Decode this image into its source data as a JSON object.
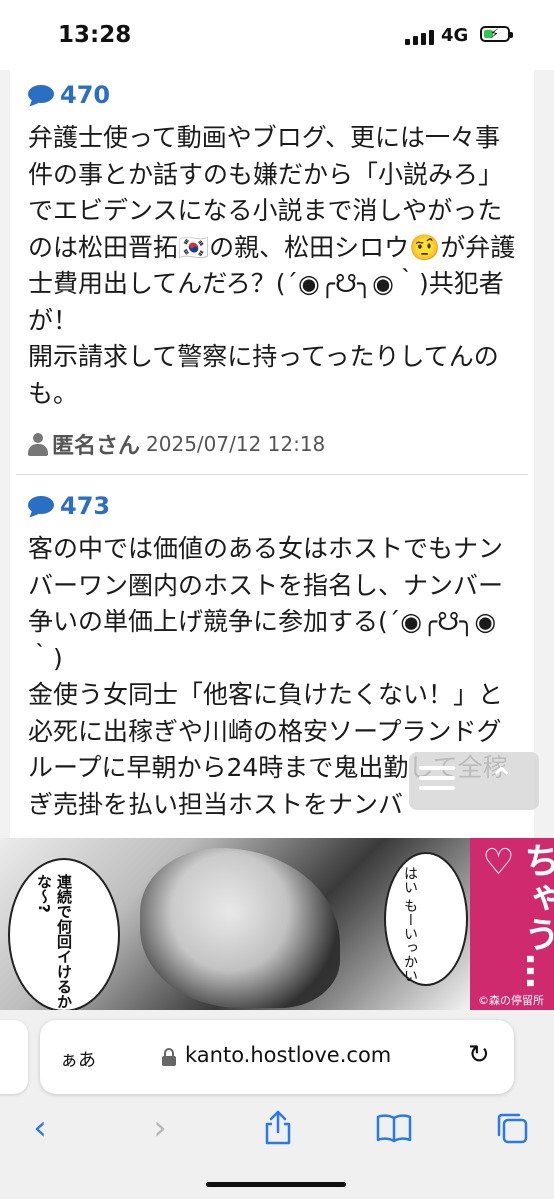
{
  "status_bar": {
    "time": "13:28",
    "network": "4G",
    "signal_icon": "cellular-signal-icon",
    "battery_icon": "battery-charging-icon"
  },
  "posts": [
    {
      "number": "470",
      "text": "弁護士使って動画やブログ、更には一々事件の事とか話すのも嫌だから「小説みろ」でエビデンスになる小説まで消しやがったのは松田晋拓🇰🇷の親、松田シロウ🤨が弁護士費用出してんだろ？(´◉╭☋╮◉｀)共犯者が！\n開示請求して警察に持ってったりしてんのも。",
      "author": "匿名さん",
      "timestamp": "2025/07/12 12:18"
    },
    {
      "number": "473",
      "text": "客の中では価値のある女はホストでもナンバーワン圏内のホストを指名し、ナンバー争いの単価上げ競争に参加する(´◉╭☋╮◉｀)\n金使う女同士「他客に負けたくない！」と必死に出稼ぎや川崎の格安ソープランドグループに早朝から24時まで鬼出勤して全稼ぎ売掛を払い担当ホストをナンバ",
      "author": "",
      "timestamp": ""
    }
  ],
  "ad": {
    "bubble_left": "連続で何回イけるかな〜?",
    "bubble_right": "はい もーいっかい",
    "title": "イかされちゃう…♡",
    "credit": "©森の停留所"
  },
  "browser": {
    "aa_label": "ぁあ",
    "url": "kanto.hostlove.com"
  },
  "colors": {
    "accent": "#2a6fc4",
    "ios_blue": "#2a7ae2",
    "ad_pink": "#cf2a6e"
  }
}
